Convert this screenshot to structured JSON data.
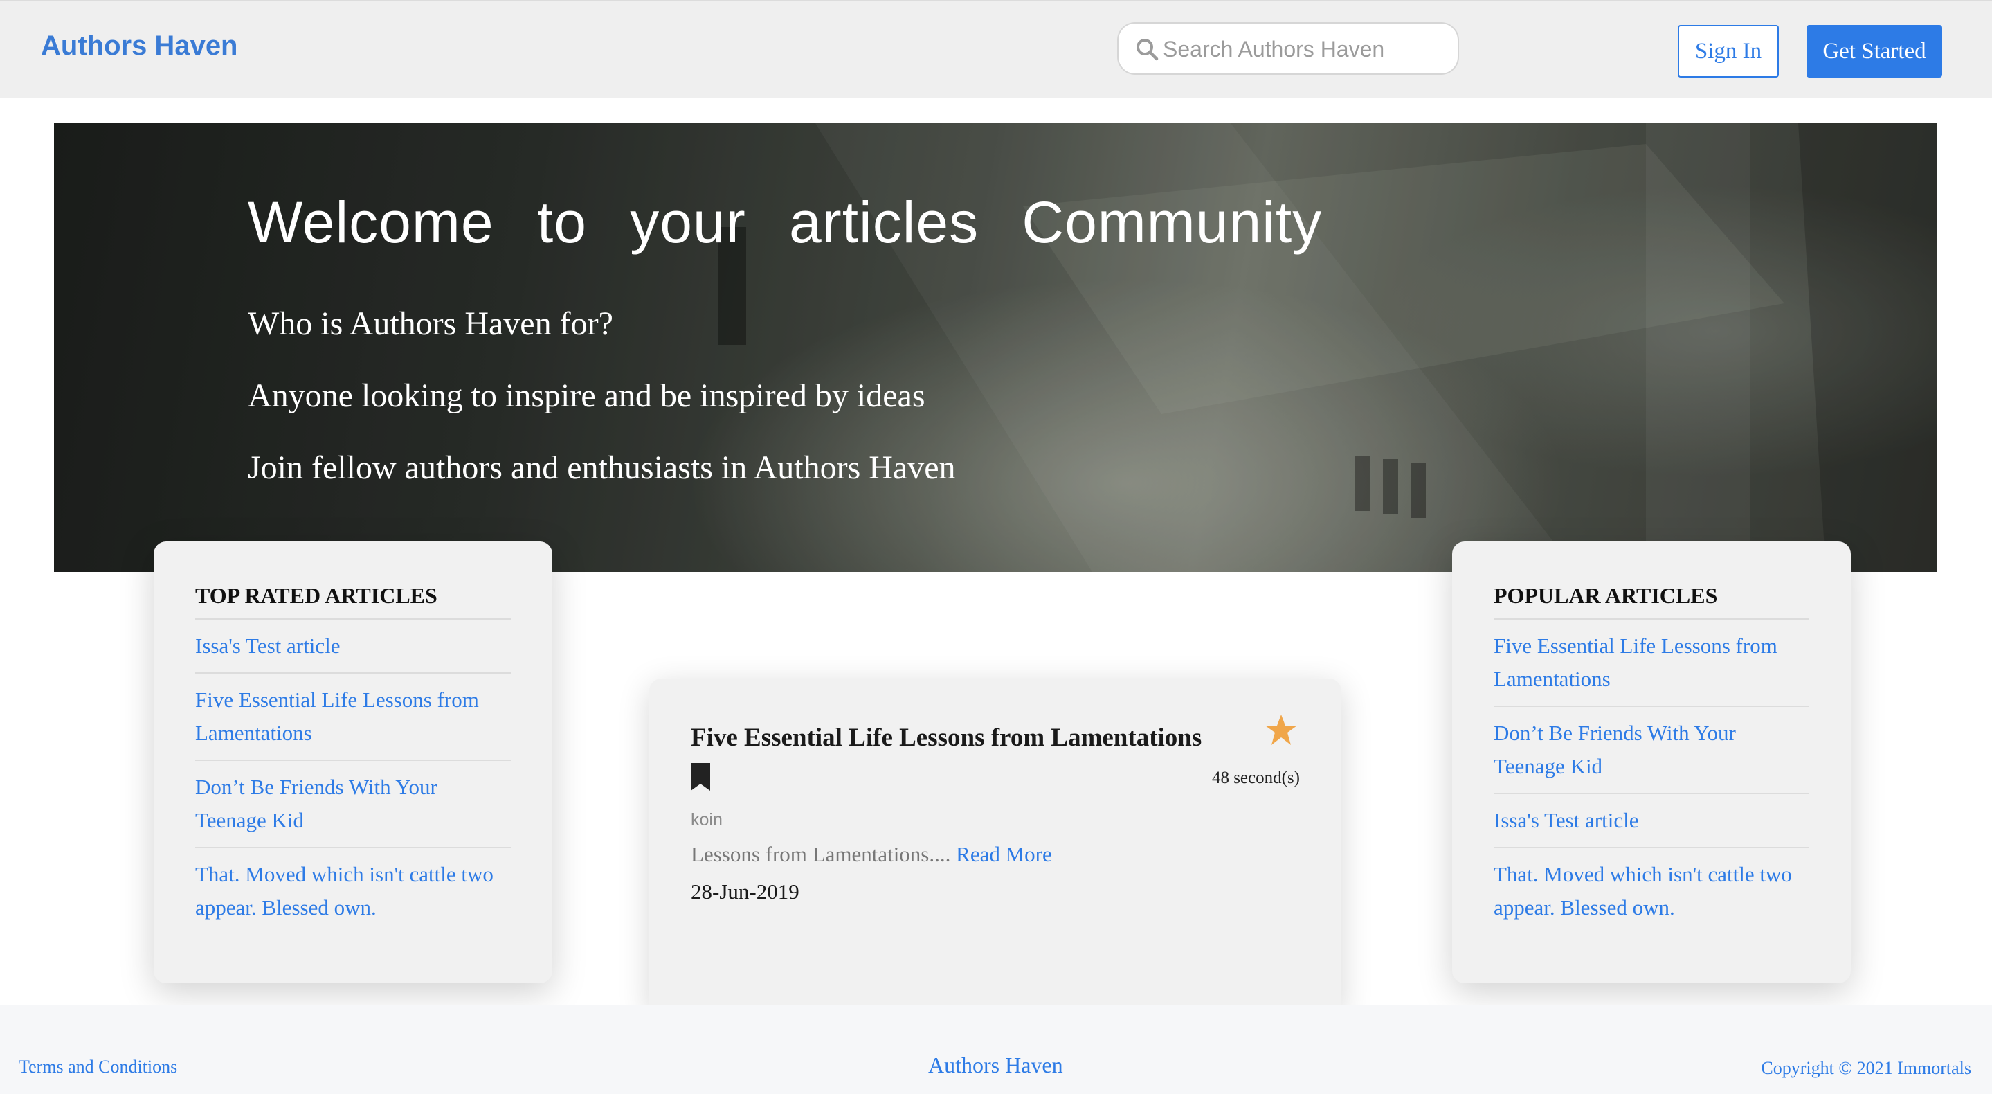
{
  "header": {
    "brand": "Authors Haven",
    "search_placeholder": "Search Authors Haven",
    "sign_in_label": "Sign In",
    "get_started_label": "Get Started"
  },
  "hero": {
    "title": "Welcome to your articles Community",
    "lines": [
      "Who is Authors Haven for?",
      "Anyone looking to inspire and be inspired by ideas",
      "Join fellow authors and enthusiasts in Authors Haven"
    ]
  },
  "top_rated": {
    "heading": "TOP RATED ARTICLES",
    "items": [
      "Issa's Test article",
      "Five Essential Life Lessons from Lamentations",
      "Don’t Be Friends With Your Teenage Kid",
      "That. Moved which isn't cattle two appear. Blessed own."
    ]
  },
  "popular": {
    "heading": "POPULAR ARTICLES",
    "items": [
      "Five Essential Life Lessons from Lamentations",
      "Don’t Be Friends With Your Teenage Kid",
      "Issa's Test article",
      "That. Moved which isn't cattle two appear. Blessed own."
    ]
  },
  "article": {
    "title": "Five Essential Life Lessons from Lamentations",
    "read_time": "48 second(s)",
    "author": "koin",
    "excerpt": "Lessons from Lamentations....",
    "read_more": " Read More",
    "date": "28-Jun-2019",
    "star_icon": "star-icon",
    "bookmark_icon": "bookmark-icon"
  },
  "footer": {
    "terms": "Terms and Conditions",
    "brand": "Authors Haven",
    "copyright": "Copyright © 2021 Immortals"
  },
  "colors": {
    "accent": "#2d7be6",
    "brand": "#3a7bd5",
    "star": "#f0a64a",
    "card_bg": "#f1f1f1",
    "nav_bg": "#efefef"
  }
}
